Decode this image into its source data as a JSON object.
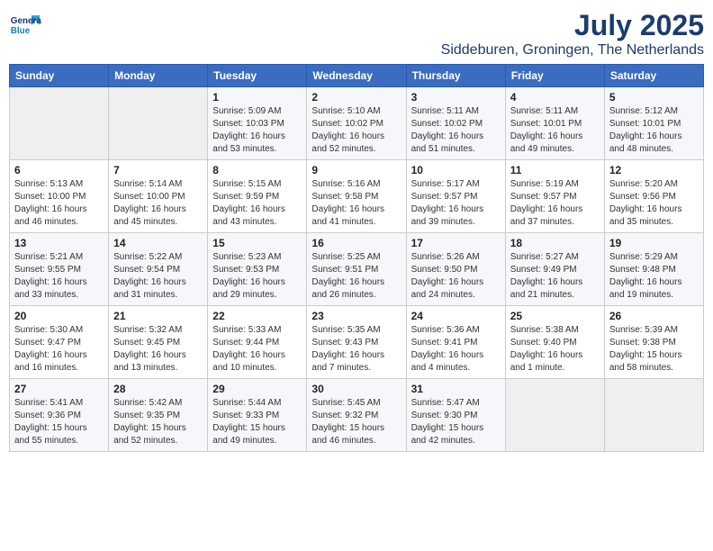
{
  "header": {
    "logo_line1": "General",
    "logo_line2": "Blue",
    "month": "July 2025",
    "location": "Siddeburen, Groningen, The Netherlands"
  },
  "days_of_week": [
    "Sunday",
    "Monday",
    "Tuesday",
    "Wednesday",
    "Thursday",
    "Friday",
    "Saturday"
  ],
  "weeks": [
    [
      {
        "day": "",
        "info": ""
      },
      {
        "day": "",
        "info": ""
      },
      {
        "day": "1",
        "info": "Sunrise: 5:09 AM\nSunset: 10:03 PM\nDaylight: 16 hours and 53 minutes."
      },
      {
        "day": "2",
        "info": "Sunrise: 5:10 AM\nSunset: 10:02 PM\nDaylight: 16 hours and 52 minutes."
      },
      {
        "day": "3",
        "info": "Sunrise: 5:11 AM\nSunset: 10:02 PM\nDaylight: 16 hours and 51 minutes."
      },
      {
        "day": "4",
        "info": "Sunrise: 5:11 AM\nSunset: 10:01 PM\nDaylight: 16 hours and 49 minutes."
      },
      {
        "day": "5",
        "info": "Sunrise: 5:12 AM\nSunset: 10:01 PM\nDaylight: 16 hours and 48 minutes."
      }
    ],
    [
      {
        "day": "6",
        "info": "Sunrise: 5:13 AM\nSunset: 10:00 PM\nDaylight: 16 hours and 46 minutes."
      },
      {
        "day": "7",
        "info": "Sunrise: 5:14 AM\nSunset: 10:00 PM\nDaylight: 16 hours and 45 minutes."
      },
      {
        "day": "8",
        "info": "Sunrise: 5:15 AM\nSunset: 9:59 PM\nDaylight: 16 hours and 43 minutes."
      },
      {
        "day": "9",
        "info": "Sunrise: 5:16 AM\nSunset: 9:58 PM\nDaylight: 16 hours and 41 minutes."
      },
      {
        "day": "10",
        "info": "Sunrise: 5:17 AM\nSunset: 9:57 PM\nDaylight: 16 hours and 39 minutes."
      },
      {
        "day": "11",
        "info": "Sunrise: 5:19 AM\nSunset: 9:57 PM\nDaylight: 16 hours and 37 minutes."
      },
      {
        "day": "12",
        "info": "Sunrise: 5:20 AM\nSunset: 9:56 PM\nDaylight: 16 hours and 35 minutes."
      }
    ],
    [
      {
        "day": "13",
        "info": "Sunrise: 5:21 AM\nSunset: 9:55 PM\nDaylight: 16 hours and 33 minutes."
      },
      {
        "day": "14",
        "info": "Sunrise: 5:22 AM\nSunset: 9:54 PM\nDaylight: 16 hours and 31 minutes."
      },
      {
        "day": "15",
        "info": "Sunrise: 5:23 AM\nSunset: 9:53 PM\nDaylight: 16 hours and 29 minutes."
      },
      {
        "day": "16",
        "info": "Sunrise: 5:25 AM\nSunset: 9:51 PM\nDaylight: 16 hours and 26 minutes."
      },
      {
        "day": "17",
        "info": "Sunrise: 5:26 AM\nSunset: 9:50 PM\nDaylight: 16 hours and 24 minutes."
      },
      {
        "day": "18",
        "info": "Sunrise: 5:27 AM\nSunset: 9:49 PM\nDaylight: 16 hours and 21 minutes."
      },
      {
        "day": "19",
        "info": "Sunrise: 5:29 AM\nSunset: 9:48 PM\nDaylight: 16 hours and 19 minutes."
      }
    ],
    [
      {
        "day": "20",
        "info": "Sunrise: 5:30 AM\nSunset: 9:47 PM\nDaylight: 16 hours and 16 minutes."
      },
      {
        "day": "21",
        "info": "Sunrise: 5:32 AM\nSunset: 9:45 PM\nDaylight: 16 hours and 13 minutes."
      },
      {
        "day": "22",
        "info": "Sunrise: 5:33 AM\nSunset: 9:44 PM\nDaylight: 16 hours and 10 minutes."
      },
      {
        "day": "23",
        "info": "Sunrise: 5:35 AM\nSunset: 9:43 PM\nDaylight: 16 hours and 7 minutes."
      },
      {
        "day": "24",
        "info": "Sunrise: 5:36 AM\nSunset: 9:41 PM\nDaylight: 16 hours and 4 minutes."
      },
      {
        "day": "25",
        "info": "Sunrise: 5:38 AM\nSunset: 9:40 PM\nDaylight: 16 hours and 1 minute."
      },
      {
        "day": "26",
        "info": "Sunrise: 5:39 AM\nSunset: 9:38 PM\nDaylight: 15 hours and 58 minutes."
      }
    ],
    [
      {
        "day": "27",
        "info": "Sunrise: 5:41 AM\nSunset: 9:36 PM\nDaylight: 15 hours and 55 minutes."
      },
      {
        "day": "28",
        "info": "Sunrise: 5:42 AM\nSunset: 9:35 PM\nDaylight: 15 hours and 52 minutes."
      },
      {
        "day": "29",
        "info": "Sunrise: 5:44 AM\nSunset: 9:33 PM\nDaylight: 15 hours and 49 minutes."
      },
      {
        "day": "30",
        "info": "Sunrise: 5:45 AM\nSunset: 9:32 PM\nDaylight: 15 hours and 46 minutes."
      },
      {
        "day": "31",
        "info": "Sunrise: 5:47 AM\nSunset: 9:30 PM\nDaylight: 15 hours and 42 minutes."
      },
      {
        "day": "",
        "info": ""
      },
      {
        "day": "",
        "info": ""
      }
    ]
  ]
}
